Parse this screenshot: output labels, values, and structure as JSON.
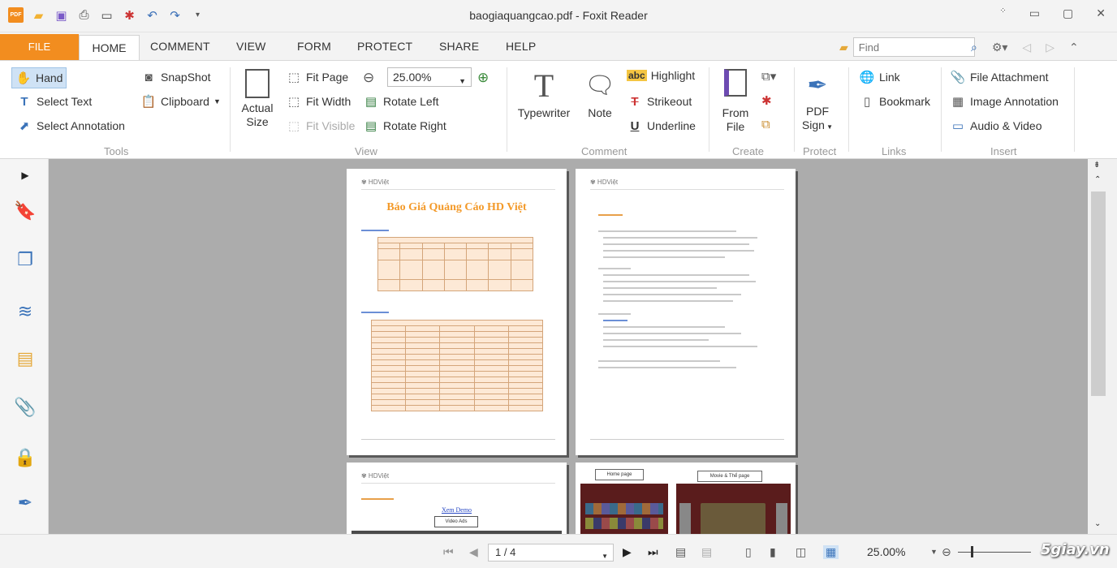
{
  "window": {
    "title": "baogiaquangcao.pdf - Foxit Reader"
  },
  "tabs": {
    "file": "FILE",
    "items": [
      "HOME",
      "COMMENT",
      "VIEW",
      "FORM",
      "PROTECT",
      "SHARE",
      "HELP"
    ],
    "active": "HOME"
  },
  "find": {
    "placeholder": "Find"
  },
  "ribbon": {
    "tools": {
      "hand": "Hand",
      "select_text": "Select Text",
      "select_annotation": "Select Annotation",
      "snapshot": "SnapShot",
      "clipboard": "Clipboard",
      "label": "Tools"
    },
    "view": {
      "actual_size_1": "Actual",
      "actual_size_2": "Size",
      "fit_page": "Fit Page",
      "fit_width": "Fit Width",
      "fit_visible": "Fit Visible",
      "zoom_value": "25.00%",
      "rotate_left": "Rotate Left",
      "rotate_right": "Rotate Right",
      "label": "View"
    },
    "comment": {
      "typewriter": "Typewriter",
      "note": "Note",
      "highlight_abc": "abc",
      "highlight": "Highlight",
      "strikeout": "Strikeout",
      "underline": "Underline",
      "label": "Comment"
    },
    "create": {
      "from_file_1": "From",
      "from_file_2": "File",
      "label": "Create"
    },
    "protect": {
      "pdf_sign_1": "PDF",
      "pdf_sign_2": "Sign",
      "label": "Protect"
    },
    "links": {
      "link": "Link",
      "bookmark": "Bookmark",
      "label": "Links"
    },
    "insert": {
      "file_attachment": "File Attachment",
      "image_annotation": "Image Annotation",
      "audio_video": "Audio & Video",
      "label": "Insert"
    }
  },
  "document": {
    "page1_title": "Báo Giá Quảng Cáo HD Việt",
    "page4_label_home": "Home page",
    "page4_label_movie": "Movie & Thể page",
    "page3_link": "Xem Demo",
    "page3_box": "Video Ads"
  },
  "status": {
    "page_value": "1 / 4",
    "zoom": "25.00%"
  },
  "watermark": "5giay.vn",
  "colors": {
    "accent": "#f28d1f",
    "icon_blue": "#3b73b9",
    "doc_bg": "#acacac",
    "title_orange": "#f39a2a"
  }
}
